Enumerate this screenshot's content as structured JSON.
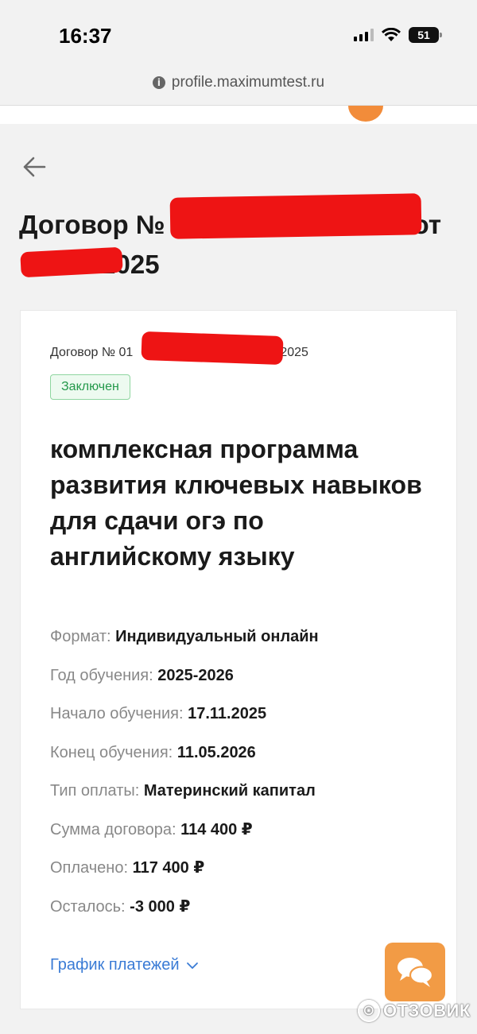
{
  "status_bar": {
    "time": "16:37",
    "battery": "51"
  },
  "browser": {
    "url": "profile.maximumtest.ru"
  },
  "page": {
    "title_prefix": "Договор № 01",
    "title_part_2": "от",
    "title_year": ".2025"
  },
  "contract": {
    "subtitle_prefix": "Договор № 01",
    "subtitle_suffix": "11.2025",
    "status": "Заключен",
    "program_title": "комплексная программа развития ключевых навыков для сдачи огэ по английскому языку",
    "details": [
      {
        "label": "Формат:",
        "value": "Индивидуальный онлайн"
      },
      {
        "label": "Год обучения:",
        "value": "2025-2026"
      },
      {
        "label": "Начало обучения:",
        "value": "17.11.2025"
      },
      {
        "label": "Конец обучения:",
        "value": "11.05.2026"
      },
      {
        "label": "Тип оплаты:",
        "value": "Материнский капитал"
      },
      {
        "label": "Сумма договора:",
        "value": "114 400 ₽"
      },
      {
        "label": "Оплачено:",
        "value": "117 400 ₽"
      },
      {
        "label": "Осталось:",
        "value": "-3 000 ₽"
      }
    ],
    "schedule_link": "График платежей"
  },
  "watermark": {
    "text": "ОТЗОВИК"
  },
  "icons": {
    "info": "info-icon",
    "back": "arrow-left-icon",
    "chevron": "chevron-down-icon",
    "chat": "chat-bubbles-icon"
  },
  "colors": {
    "accent": "#3a7bd5",
    "status_green": "#23984a",
    "chat_orange": "#f29b45",
    "redaction": "#ee1414"
  }
}
